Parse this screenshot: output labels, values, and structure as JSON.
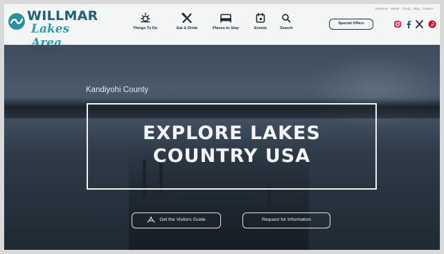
{
  "brand": {
    "logo_line1": "WILLMAR",
    "logo_line2": "Lakes Area"
  },
  "nav": {
    "items": [
      {
        "label": "Things To Do",
        "icon": "sun-icon"
      },
      {
        "label": "Eat & Drink",
        "icon": "fork-knife-icon"
      },
      {
        "label": "Places to Stay",
        "icon": "bed-icon"
      },
      {
        "label": "Events",
        "icon": "calendar-icon"
      },
      {
        "label": "Search",
        "icon": "search-icon"
      }
    ],
    "special_offers": "Special Offers"
  },
  "utility_links": "Business  Media  Group  Blog  Contact",
  "social": [
    "instagram-icon",
    "facebook-icon",
    "x-icon",
    "pinterest-icon"
  ],
  "hero": {
    "kicker": "Kandiyohi County",
    "headline_line1": "EXPLORE LAKES",
    "headline_line2": "COUNTRY USA",
    "cta_guide": "Get the Visitors Guide",
    "cta_info": "Request for Information"
  },
  "colors": {
    "brand_dark": "#1f5f7a",
    "brand_teal": "#2b9ab0",
    "instagram": "#d6336c",
    "facebook": "#1d4fa3",
    "pinterest": "#c8102e"
  }
}
